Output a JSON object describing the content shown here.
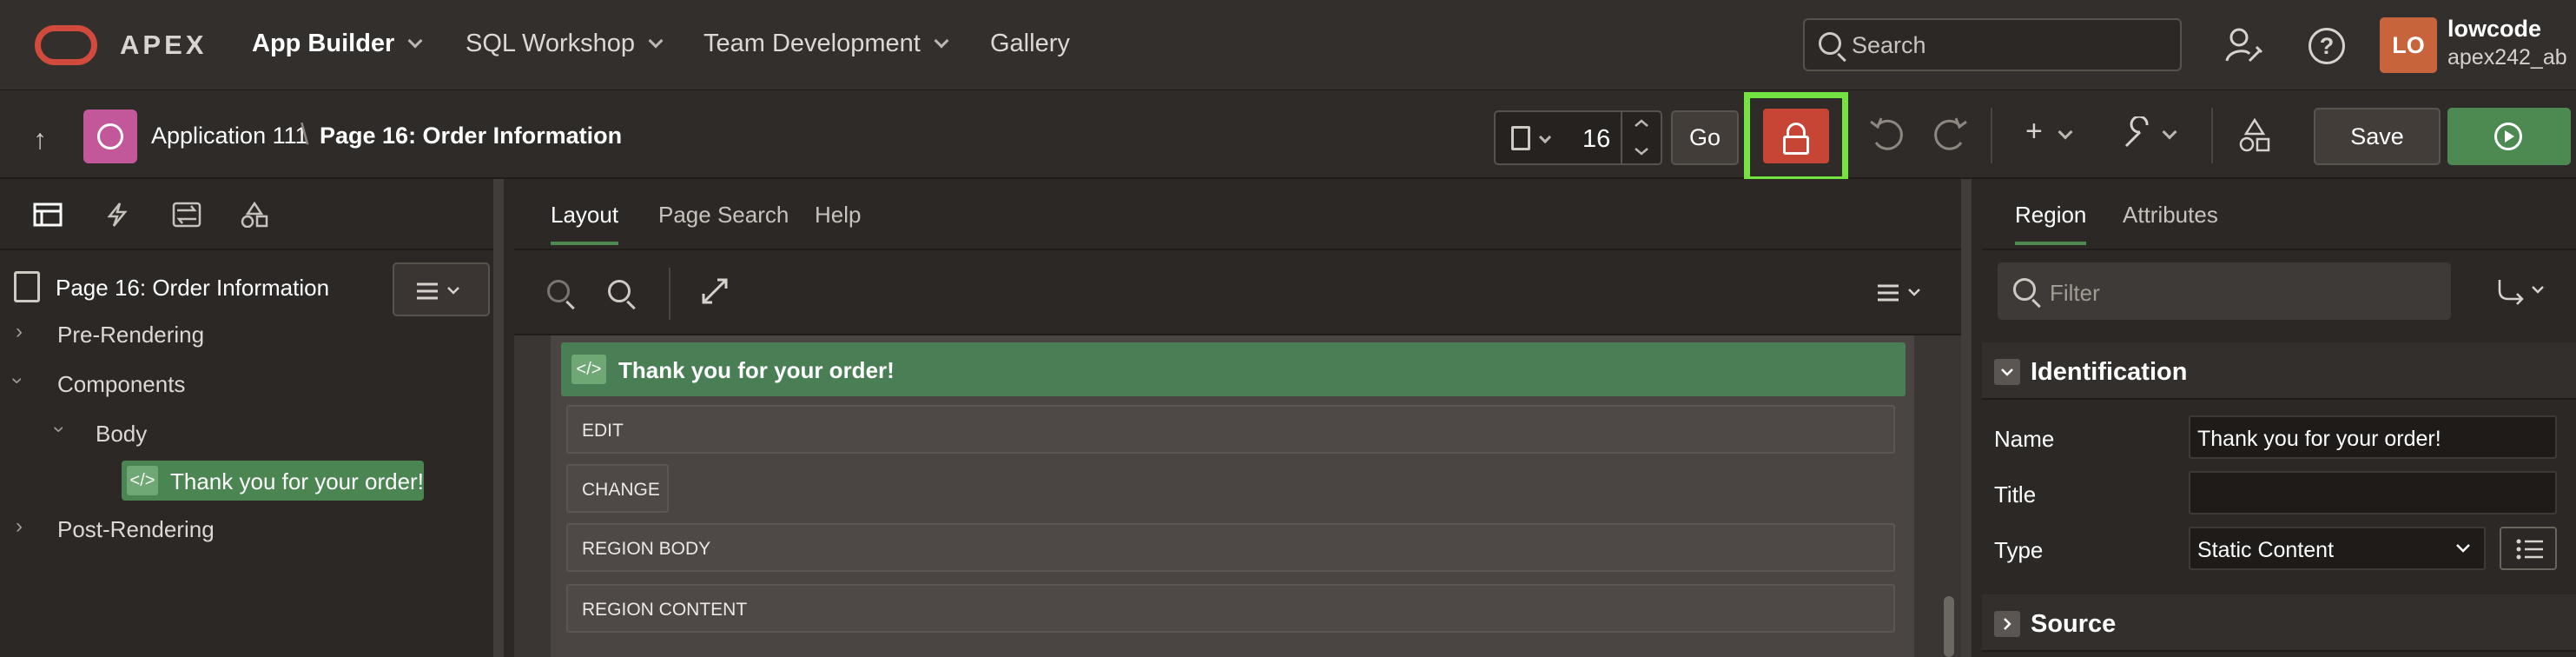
{
  "topnav": {
    "brand": "APEX",
    "items": [
      {
        "label": "App Builder"
      },
      {
        "label": "SQL Workshop"
      },
      {
        "label": "Team Development"
      },
      {
        "label": "Gallery"
      }
    ],
    "search_placeholder": "Search",
    "help_glyph": "?",
    "user": {
      "initials": "LO",
      "name": "lowcode",
      "workspace": "apex242_ab"
    }
  },
  "toolbar": {
    "up_glyph": "↑",
    "app_name": "Application 111",
    "separator": "\\",
    "page_name": "Page 16: Order Information",
    "page_number": "16",
    "go_label": "Go",
    "save_label": "Save",
    "lock_color": "#c74535",
    "highlight_color": "#74e342"
  },
  "left_panel": {
    "tree_title": "Page 16: Order Information",
    "nodes": [
      {
        "label": "Pre-Rendering"
      },
      {
        "label": "Components"
      },
      {
        "label": "Body"
      },
      {
        "label": "Thank you for your order!"
      },
      {
        "label": "Post-Rendering"
      }
    ]
  },
  "center": {
    "tabs": [
      {
        "label": "Layout",
        "active": true
      },
      {
        "label": "Page Search"
      },
      {
        "label": "Help"
      }
    ],
    "region_title": "Thank you for your order!",
    "slots": [
      "EDIT",
      "CHANGE",
      "REGION BODY",
      "REGION CONTENT"
    ]
  },
  "right_panel": {
    "tabs": [
      {
        "label": "Region",
        "active": true
      },
      {
        "label": "Attributes"
      }
    ],
    "filter_placeholder": "Filter",
    "groups": {
      "identification": "Identification",
      "source": "Source"
    },
    "props": {
      "name_label": "Name",
      "name_value": "Thank you for your order!",
      "title_label": "Title",
      "title_value": "",
      "type_label": "Type",
      "type_value": "Static Content"
    }
  }
}
